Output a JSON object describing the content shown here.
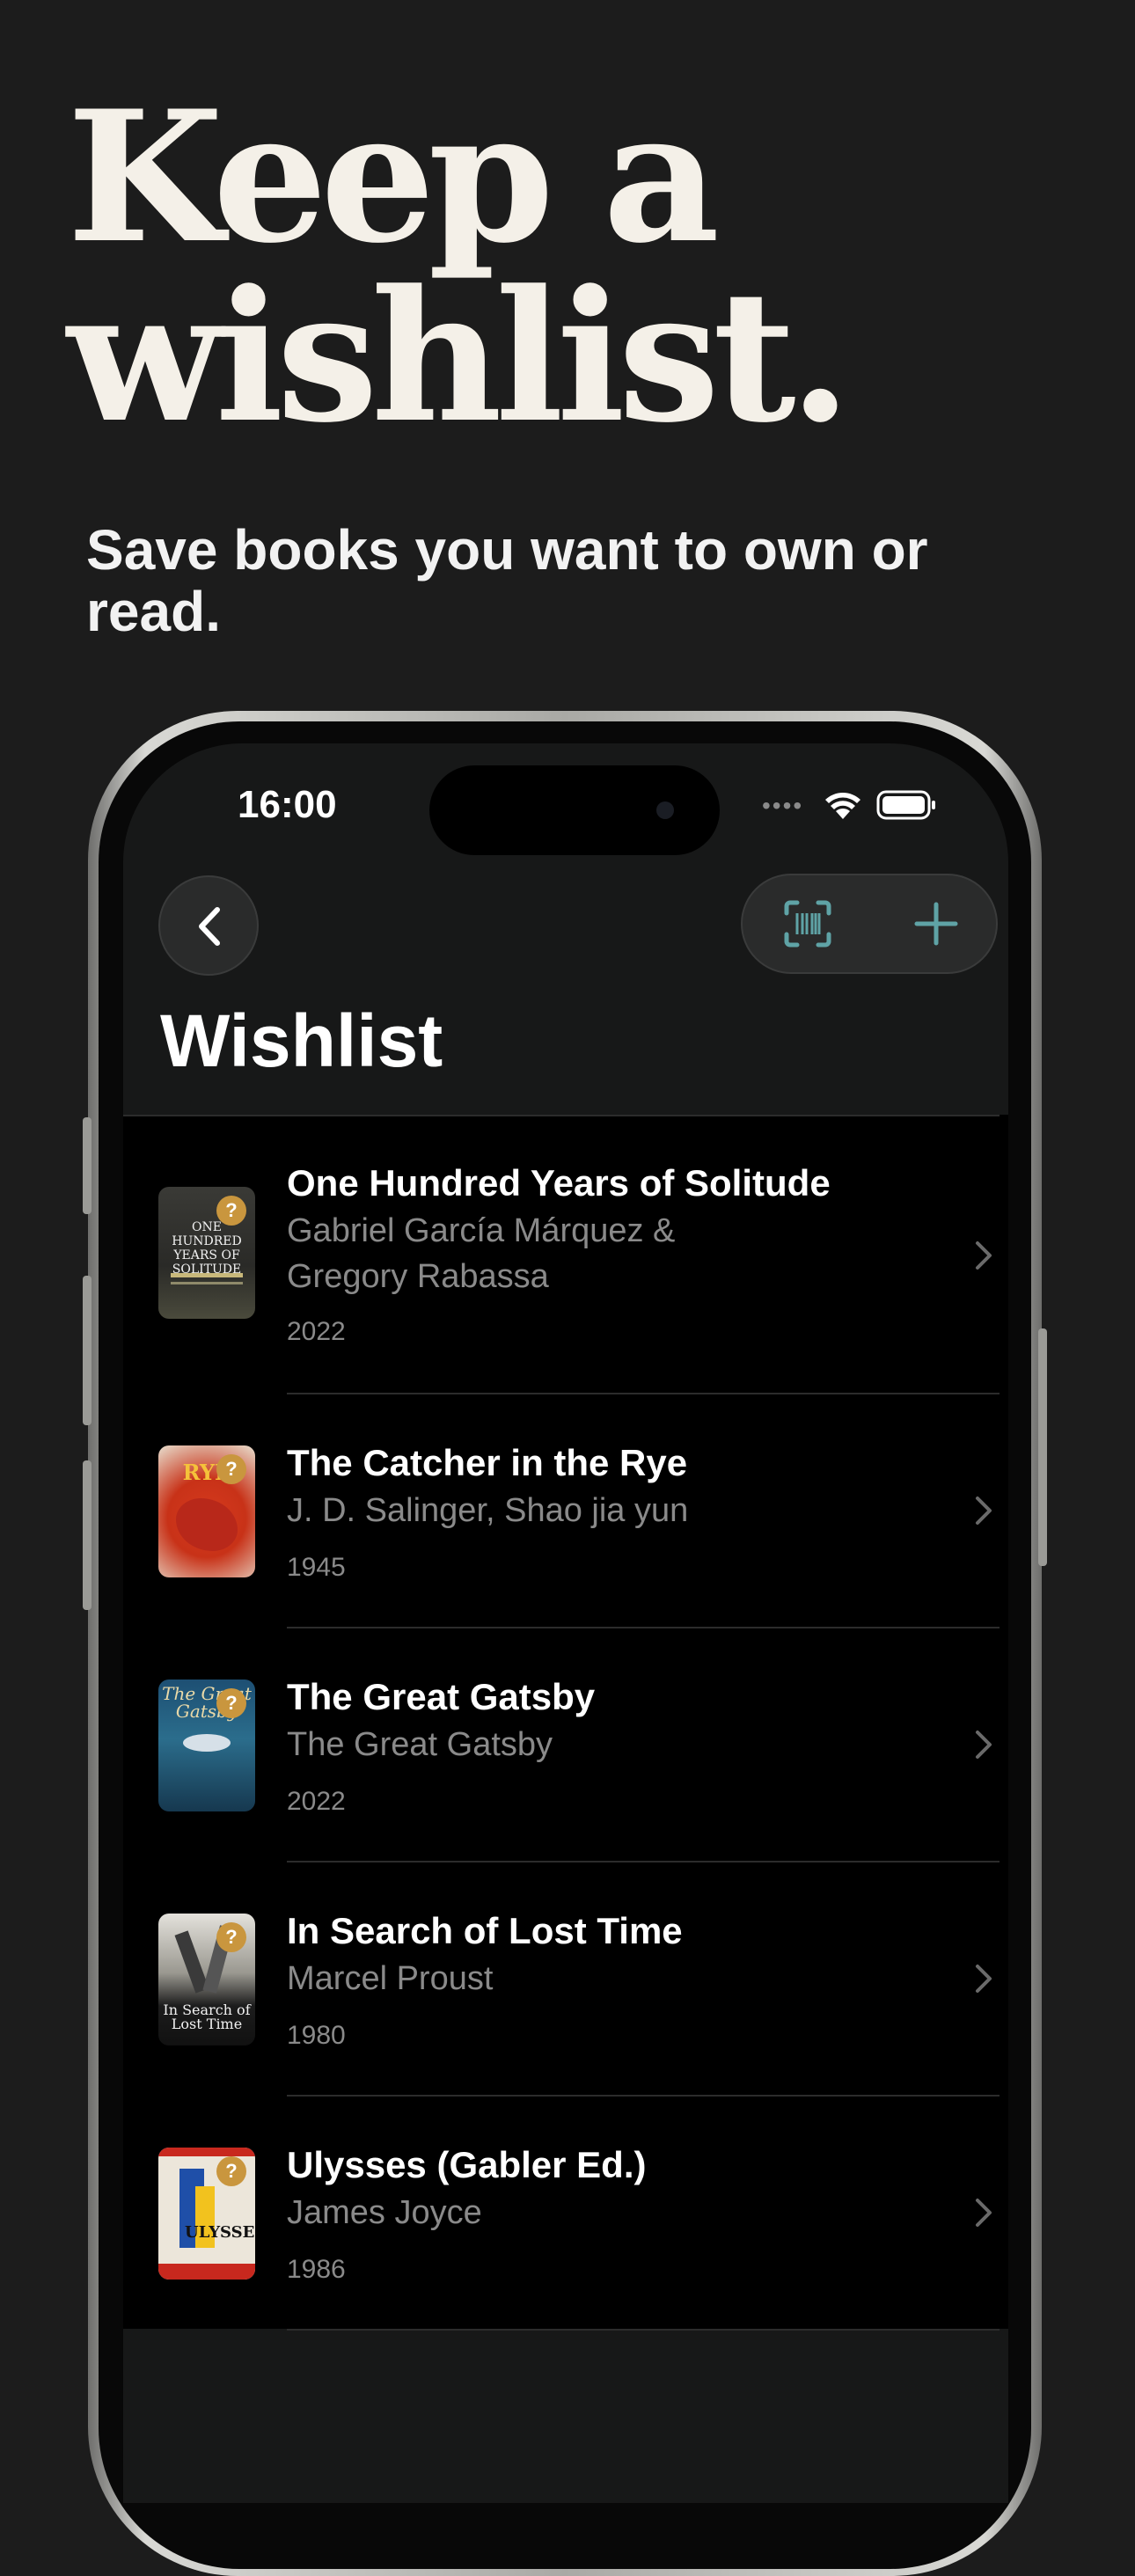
{
  "promo": {
    "headline_line1": "Keep a",
    "headline_line2": "wishlist.",
    "subheading": "Save books you want to own or read."
  },
  "status_bar": {
    "time": "16:00"
  },
  "nav": {
    "back_icon": "chevron-left-icon",
    "scan_icon": "barcode-scan-icon",
    "add_icon": "plus-icon",
    "accent_color": "#5fa3a6"
  },
  "page": {
    "title": "Wishlist"
  },
  "books": [
    {
      "title": "One Hundred Years of Solitude",
      "author": "Gabriel García Márquez & Gregory Rabassa",
      "year": "2022",
      "badge": "?",
      "cover_text": "ONE HUNDRED YEARS OF SOLITUDE"
    },
    {
      "title": "The Catcher in the Rye",
      "author": "J. D. Salinger, Shao jia yun",
      "year": "1945",
      "badge": "?",
      "cover_text": "RYE"
    },
    {
      "title": "The Great Gatsby",
      "author": "The Great Gatsby",
      "year": "2022",
      "badge": "?",
      "cover_text": "The Great Gatsby"
    },
    {
      "title": "In Search of Lost Time",
      "author": "Marcel Proust",
      "year": "1980",
      "badge": "?",
      "cover_text": "In Search of Lost Time"
    },
    {
      "title": "Ulysses (Gabler Ed.)",
      "author": "James Joyce",
      "year": "1986",
      "badge": "?",
      "cover_text": "ULYSSES"
    }
  ]
}
